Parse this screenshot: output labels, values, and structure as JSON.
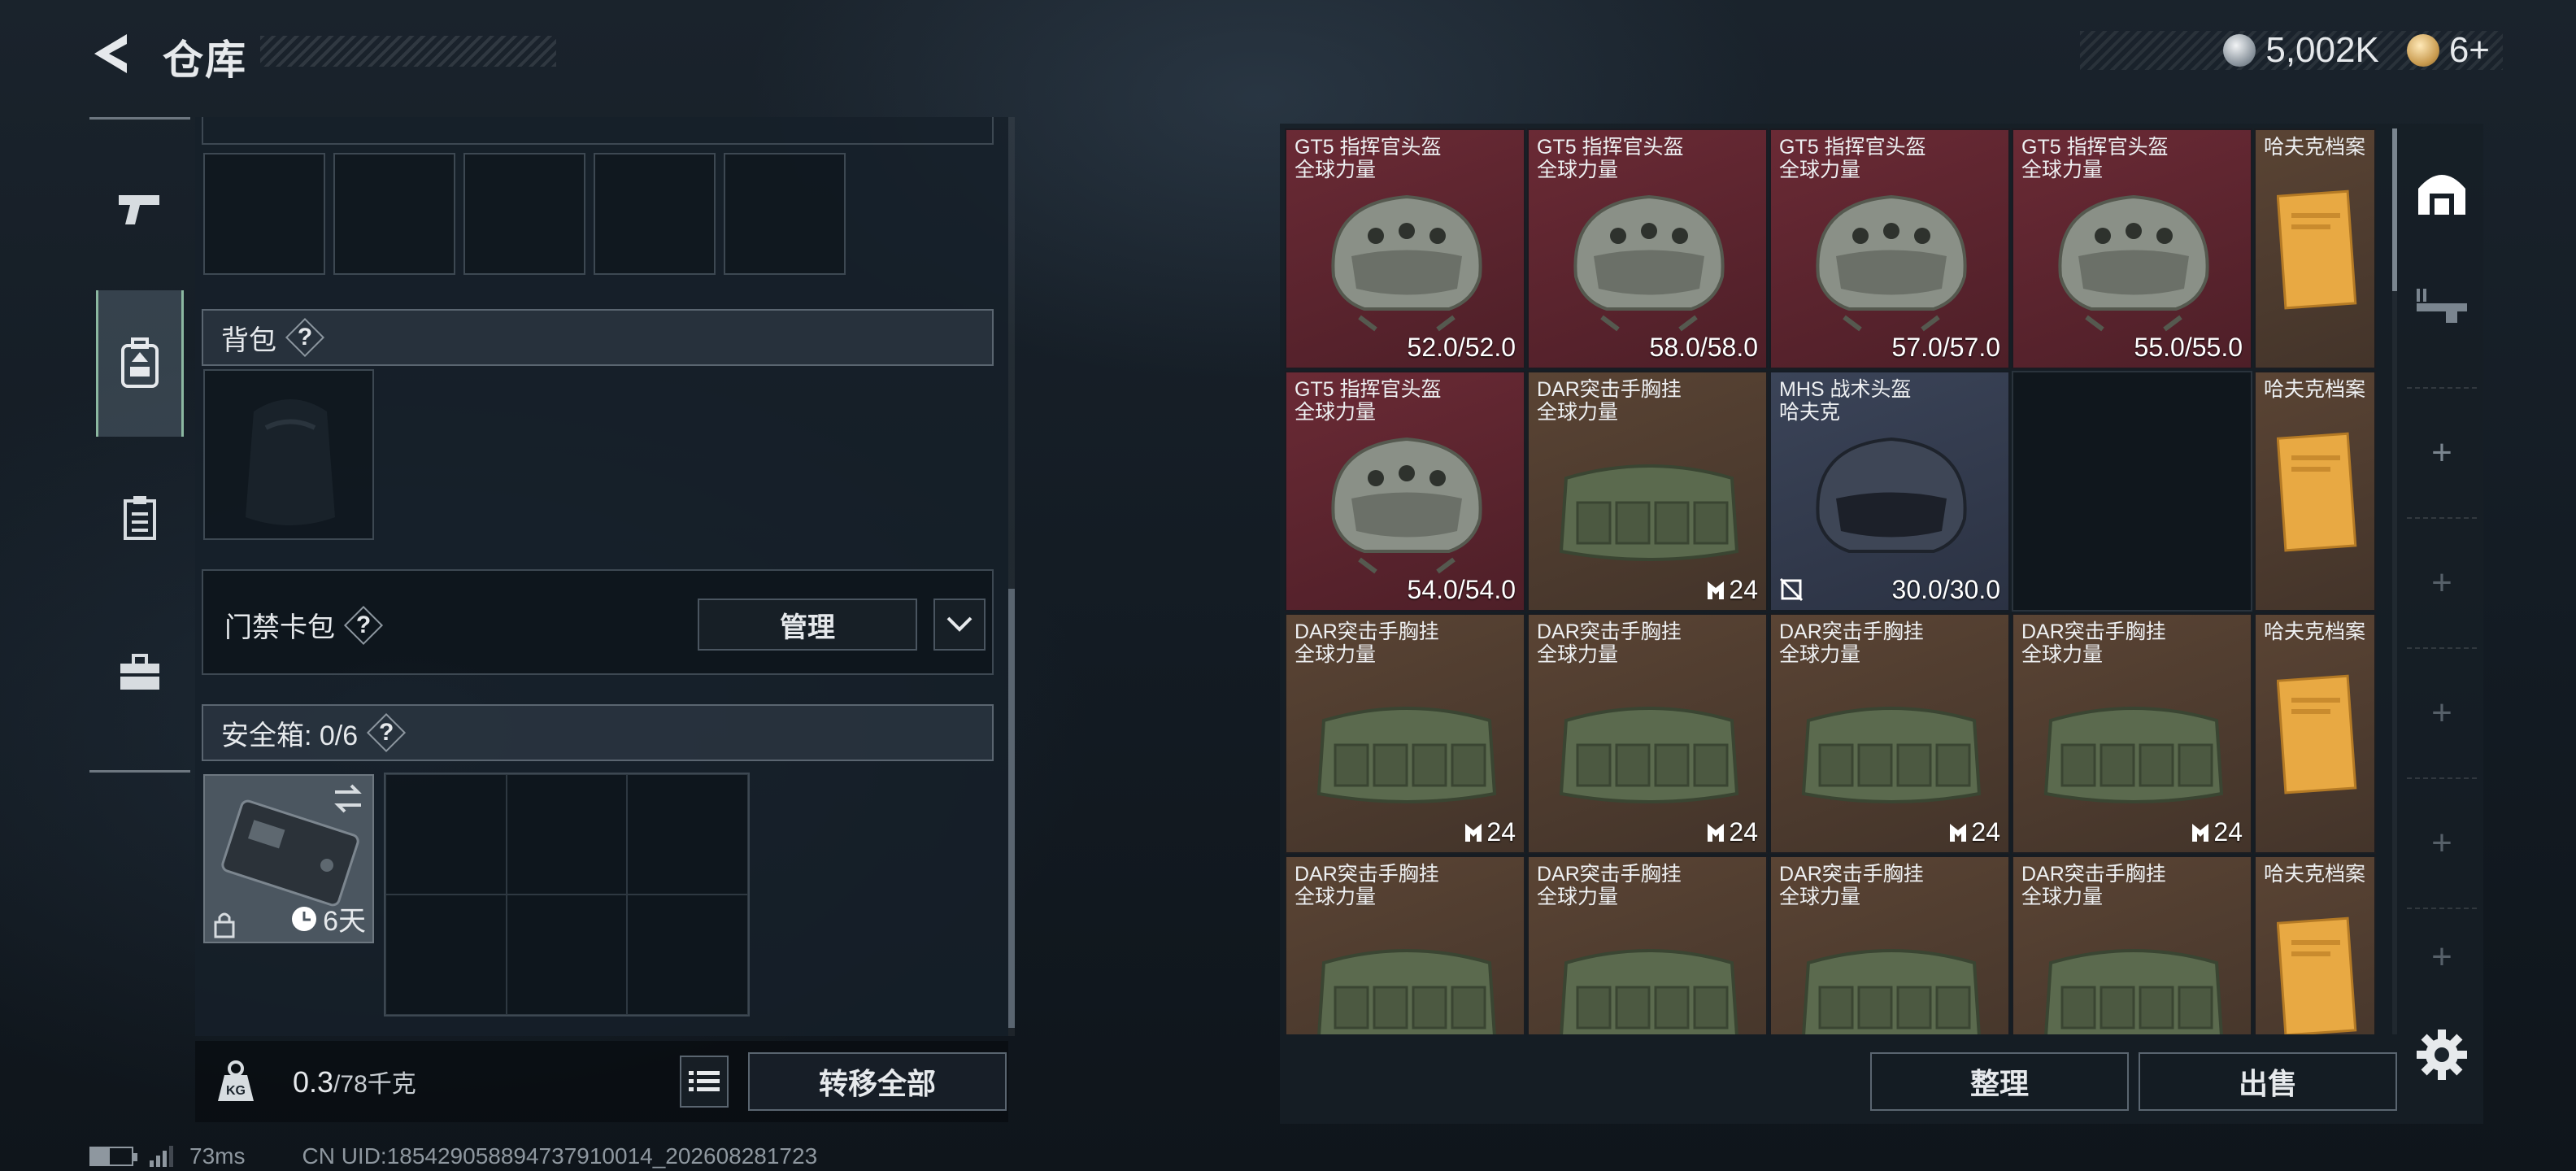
{
  "header": {
    "title": "仓库",
    "currency": [
      {
        "icon": "silver-coin-icon",
        "value": "5,002K"
      },
      {
        "icon": "gold-coin-icon",
        "value": "6+"
      }
    ]
  },
  "left_nav": [
    {
      "name": "nav-weapons",
      "icon": "pistol-icon"
    },
    {
      "name": "nav-equipment",
      "icon": "backpack-badge-icon",
      "active": true
    },
    {
      "name": "nav-clipboard",
      "icon": "clipboard-icon"
    },
    {
      "name": "nav-toolbox",
      "icon": "toolbox-icon"
    }
  ],
  "loadout": {
    "backpack_label": "背包",
    "keycard_label": "门禁卡包",
    "manage_label": "管理",
    "safebox_label": "安全箱: 0/6",
    "safebox_timer": "6天",
    "help": "?"
  },
  "footer_left": {
    "weight_current": "0.3",
    "weight_capacity": "/78千克",
    "kg_badge": "KG",
    "transfer_all": "转移全部"
  },
  "storage": {
    "items": [
      {
        "name": "GT5 指挥官头盔",
        "sub": "全球力量",
        "color": "red",
        "type": "helmet",
        "durability": "52.0/52.0"
      },
      {
        "name": "GT5 指挥官头盔",
        "sub": "全球力量",
        "color": "red",
        "type": "helmet",
        "durability": "58.0/58.0"
      },
      {
        "name": "GT5 指挥官头盔",
        "sub": "全球力量",
        "color": "red",
        "type": "helmet",
        "durability": "57.0/57.0"
      },
      {
        "name": "GT5 指挥官头盔",
        "sub": "全球力量",
        "color": "red",
        "type": "helmet",
        "durability": "55.0/55.0"
      },
      {
        "name": "哈夫克档案",
        "color": "brown",
        "type": "folder",
        "narrow": true
      },
      {
        "name": "GT5 指挥官头盔",
        "sub": "全球力量",
        "color": "red",
        "type": "helmet",
        "durability": "54.0/54.0"
      },
      {
        "name": "DAR突击手胸挂",
        "sub": "全球力量",
        "color": "brown",
        "type": "rig",
        "count": "24"
      },
      {
        "name": "MHS 战术头盔",
        "sub": "哈夫克",
        "color": "blue",
        "type": "helmet-dark",
        "durability": "30.0/30.0"
      },
      {
        "type": "empty"
      },
      {
        "name": "哈夫克档案",
        "color": "brown",
        "type": "folder",
        "narrow": true
      },
      {
        "name": "DAR突击手胸挂",
        "sub": "全球力量",
        "color": "brown",
        "type": "rig",
        "count": "24"
      },
      {
        "name": "DAR突击手胸挂",
        "sub": "全球力量",
        "color": "brown",
        "type": "rig",
        "count": "24"
      },
      {
        "name": "DAR突击手胸挂",
        "sub": "全球力量",
        "color": "brown",
        "type": "rig",
        "count": "24"
      },
      {
        "name": "DAR突击手胸挂",
        "sub": "全球力量",
        "color": "brown",
        "type": "rig",
        "count": "24"
      },
      {
        "name": "哈夫克档案",
        "color": "brown",
        "type": "folder",
        "narrow": true
      },
      {
        "name": "DAR突击手胸挂",
        "sub": "全球力量",
        "color": "brown",
        "type": "rig"
      },
      {
        "name": "DAR突击手胸挂",
        "sub": "全球力量",
        "color": "brown",
        "type": "rig"
      },
      {
        "name": "DAR突击手胸挂",
        "sub": "全球力量",
        "color": "brown",
        "type": "rig"
      },
      {
        "name": "DAR突击手胸挂",
        "sub": "全球力量",
        "color": "brown",
        "type": "rig"
      },
      {
        "name": "哈夫克档案",
        "color": "brown",
        "type": "folder",
        "narrow": true
      }
    ],
    "sort_label": "整理",
    "sell_label": "出售"
  },
  "status_bar": {
    "ping": "73ms",
    "uid": "CN UID:185429058894737910014_202608281723"
  },
  "colors": {
    "red_cell": "#5e2530",
    "brown_cell": "#4e3c2f",
    "blue_cell": "#343c4f",
    "accent_green": "#8bb7a0"
  }
}
